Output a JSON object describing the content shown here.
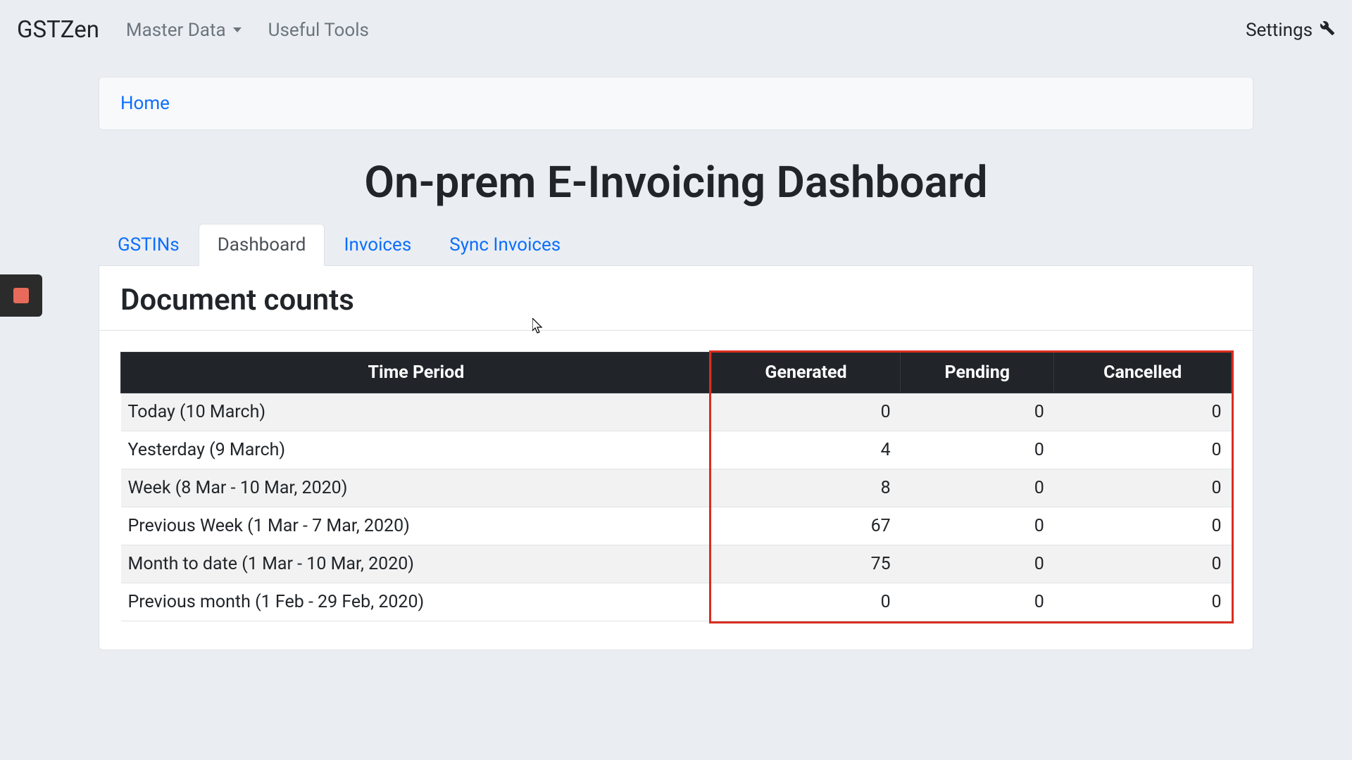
{
  "navbar": {
    "brand": "GSTZen",
    "master_data": "Master Data",
    "useful_tools": "Useful Tools",
    "settings": "Settings"
  },
  "breadcrumb": {
    "home": "Home"
  },
  "page_title": "On-prem E-Invoicing Dashboard",
  "tabs": {
    "gstins": "GSTINs",
    "dashboard": "Dashboard",
    "invoices": "Invoices",
    "sync_invoices": "Sync Invoices"
  },
  "panel": {
    "title": "Document counts"
  },
  "table": {
    "headers": {
      "time_period": "Time Period",
      "generated": "Generated",
      "pending": "Pending",
      "cancelled": "Cancelled"
    },
    "rows": [
      {
        "period": "Today (10 March)",
        "generated": "0",
        "pending": "0",
        "cancelled": "0"
      },
      {
        "period": "Yesterday (9 March)",
        "generated": "4",
        "pending": "0",
        "cancelled": "0"
      },
      {
        "period": "Week (8 Mar - 10 Mar, 2020)",
        "generated": "8",
        "pending": "0",
        "cancelled": "0"
      },
      {
        "period": "Previous Week (1 Mar - 7 Mar, 2020)",
        "generated": "67",
        "pending": "0",
        "cancelled": "0"
      },
      {
        "period": "Month to date (1 Mar - 10 Mar, 2020)",
        "generated": "75",
        "pending": "0",
        "cancelled": "0"
      },
      {
        "period": "Previous month (1 Feb - 29 Feb, 2020)",
        "generated": "0",
        "pending": "0",
        "cancelled": "0"
      }
    ]
  }
}
